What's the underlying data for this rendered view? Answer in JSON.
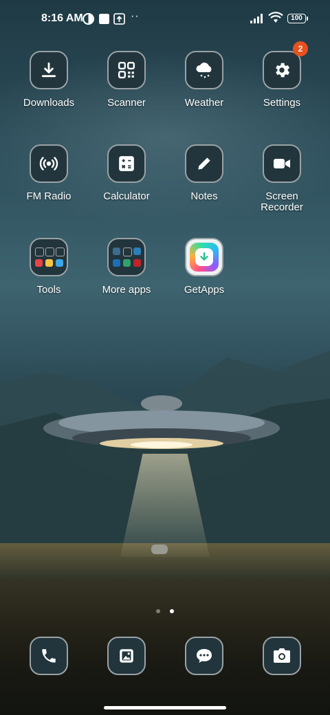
{
  "status_bar": {
    "time": "8:16 AM",
    "icons": [
      "data-saver-icon",
      "square-notification-icon",
      "upload-notification-icon",
      "more-notifications-icon"
    ],
    "signal": "signal-icon",
    "wifi": "wifi-icon",
    "battery": "100"
  },
  "home": {
    "apps": [
      {
        "label": "Downloads",
        "icon": "download-icon"
      },
      {
        "label": "Scanner",
        "icon": "qr-scanner-icon"
      },
      {
        "label": "Weather",
        "icon": "weather-cloud-icon"
      },
      {
        "label": "Settings",
        "icon": "gear-icon",
        "badge": "2"
      },
      {
        "label": "FM Radio",
        "icon": "radio-icon"
      },
      {
        "label": "Calculator",
        "icon": "calculator-icon"
      },
      {
        "label": "Notes",
        "icon": "pencil-icon"
      },
      {
        "label": "Screen Recorder",
        "icon": "video-camera-icon"
      },
      {
        "label": "Tools",
        "icon": "folder-icon"
      },
      {
        "label": "More apps",
        "icon": "folder-icon"
      },
      {
        "label": "GetApps",
        "icon": "getapps-icon"
      }
    ],
    "page_count": 2,
    "active_page": 2
  },
  "dock": [
    {
      "icon": "phone-icon"
    },
    {
      "icon": "gallery-icon"
    },
    {
      "icon": "messages-icon"
    },
    {
      "icon": "camera-icon"
    }
  ],
  "colors": {
    "tile_bg": "#22353c",
    "tile_border": "#9aa3a6",
    "badge": "#e8511e"
  }
}
